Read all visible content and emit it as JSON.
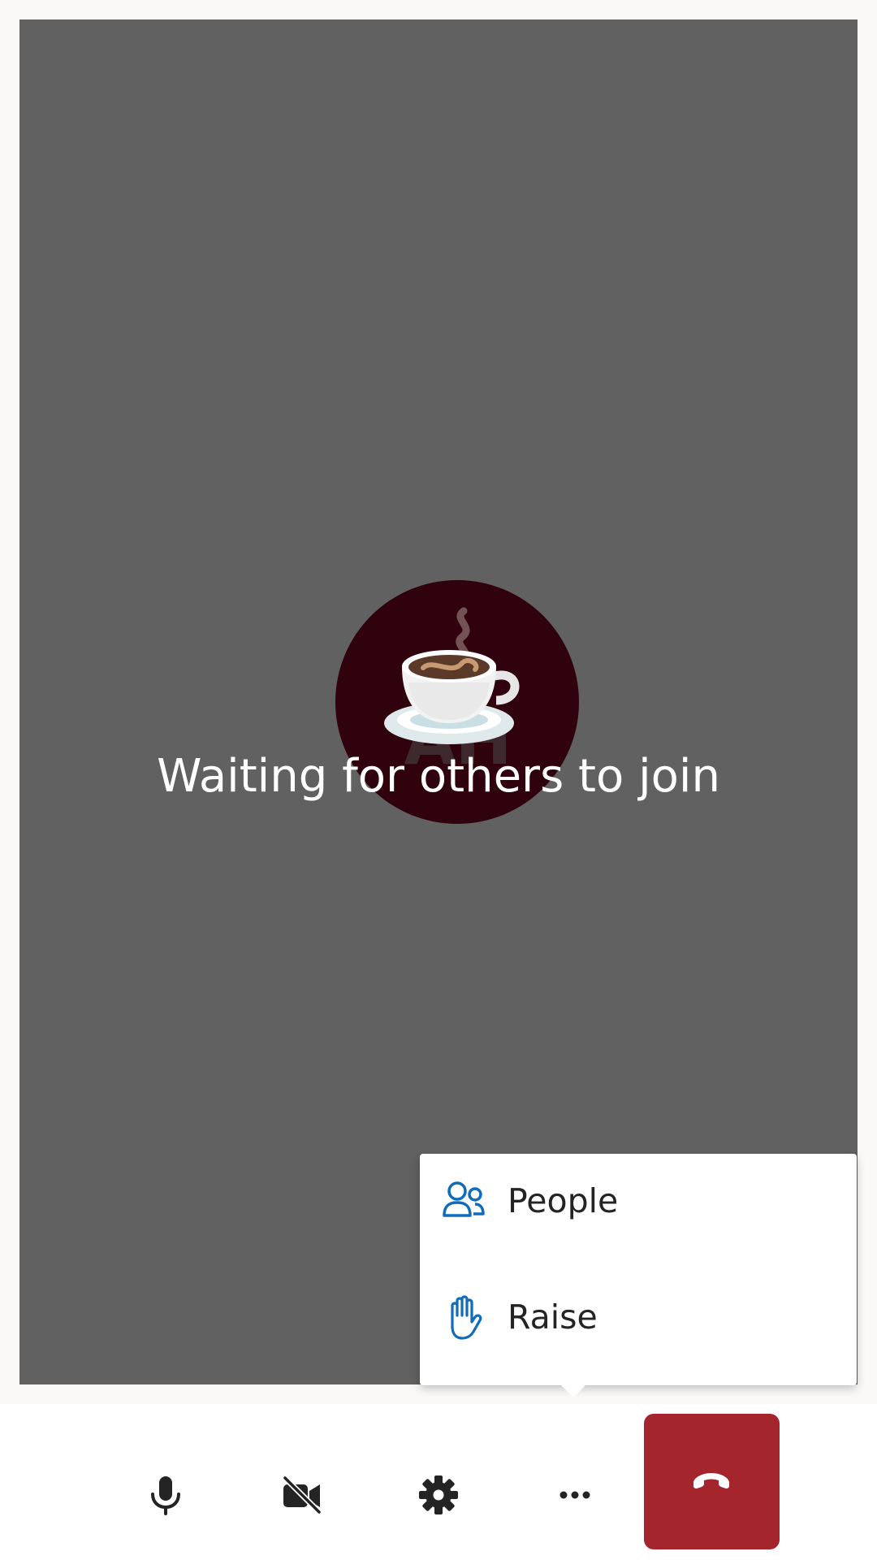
{
  "call": {
    "status_text": "Waiting for others to join",
    "avatar": {
      "initials": "AH",
      "emoji_icon": "coffee-cup-icon",
      "background": "#2f020d"
    },
    "stage_background": "#616161"
  },
  "more_menu": {
    "items": [
      {
        "label": "People",
        "icon": "people-icon"
      },
      {
        "label": "Raise",
        "icon": "raise-hand-icon"
      }
    ],
    "icon_color": "#0f6cbd"
  },
  "toolbar": {
    "buttons": [
      {
        "name": "microphone",
        "icon": "microphone-icon"
      },
      {
        "name": "camera-off",
        "icon": "video-off-icon"
      },
      {
        "name": "settings",
        "icon": "gear-icon"
      },
      {
        "name": "more",
        "icon": "more-horizontal-icon"
      },
      {
        "name": "hang-up",
        "icon": "phone-hangup-icon"
      }
    ],
    "hangup_color": "#a4262c"
  }
}
